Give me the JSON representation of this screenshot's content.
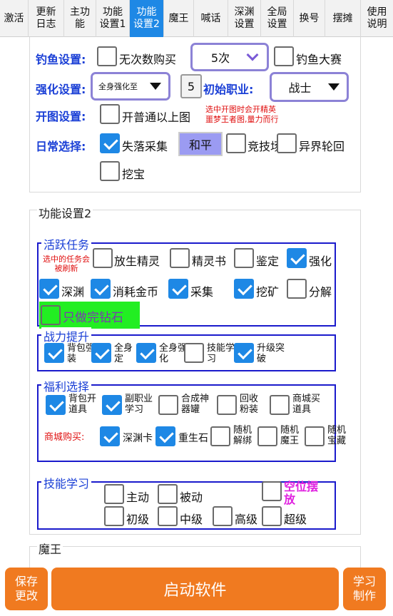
{
  "tabs": [
    {
      "label": "激活",
      "active": false
    },
    {
      "label": "更新\n日志",
      "active": false
    },
    {
      "label": "主功\n能",
      "active": false
    },
    {
      "label": "功能\n设置1",
      "active": false
    },
    {
      "label": "功能\n设置2",
      "active": true
    },
    {
      "label": "魔王",
      "active": false
    },
    {
      "label": "喊话",
      "active": false
    },
    {
      "label": "深渊\n设置",
      "active": false
    },
    {
      "label": "全局\n设置",
      "active": false
    },
    {
      "label": "换号",
      "active": false
    },
    {
      "label": "摆摊",
      "active": false
    },
    {
      "label": "使用\n说明",
      "active": false
    }
  ],
  "top": {
    "fishing_label": "钓鱼设置:",
    "no_buy_limit": "无次数购买",
    "fishing_count": "5次",
    "fishing_contest": "钓鱼大赛",
    "enhance_label": "强化设置:",
    "enhance_value": "全身强化至",
    "enhance_level": "5",
    "init_job_label": "初始职业:",
    "init_job_value": "战士",
    "map_label": "开图设置:",
    "map_option": "开普通以上图",
    "map_note": "选中开图时会开精英\n噩梦王者图,量力而行",
    "daily_label": "日常选择:",
    "lost_collect": "失落采集",
    "peace_button": "和平",
    "arena": "竞技场",
    "otherworld": "异界轮回",
    "dig": "挖宝"
  },
  "section2": {
    "title": "功能设置2",
    "active_tasks": {
      "title": "活跃任务",
      "note": "选中的任务会\n被刷新",
      "items": [
        "放生精灵",
        "精灵书",
        "鉴定",
        "强化",
        "深渊",
        "消耗金币",
        "采集",
        "挖矿",
        "分解"
      ],
      "diamond": "只做完钻石"
    },
    "power": {
      "title": "战力提升",
      "items": [
        "背包强\n装",
        "全身\n定",
        "全身强\n化",
        "技能学\n习",
        "升级突\n破"
      ]
    },
    "welfare": {
      "title": "福利选择",
      "items": [
        "背包开\n道具",
        "副职业\n学习",
        "合成神\n器罐",
        "回收\n粉装",
        "商城买\n道具"
      ],
      "shop_label": "商城购买:",
      "shop_items": [
        "深渊卡",
        "重生石",
        "随机\n解绑",
        "随机\n魔王",
        "随机\n宝藏"
      ]
    },
    "skills": {
      "title": "技能学习",
      "items": [
        "主动",
        "被动",
        "初级",
        "中级",
        "高级",
        "超级"
      ],
      "empty_slot": "空位摆\n放"
    }
  },
  "section3": {
    "title": "魔王"
  },
  "bottom": {
    "save": "保存\n更改",
    "start": "启动软件",
    "learn": "学习\n制作"
  },
  "colors": {
    "accent": "#1e88e5",
    "label_blue": "#1a3fd6",
    "orange": "#f07a20",
    "green": "#22ee22",
    "purple_border": "#8c82d6",
    "magenta": "#e020e0"
  }
}
